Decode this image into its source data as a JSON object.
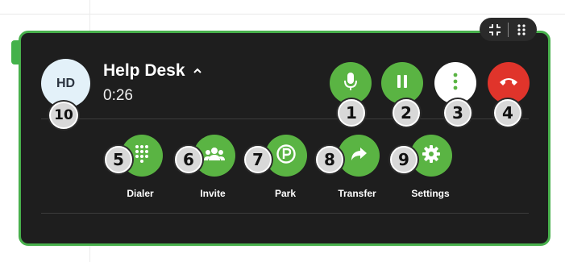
{
  "call": {
    "contact_initials": "HD",
    "contact_name": "Help Desk",
    "duration": "0:26"
  },
  "controls": {
    "mute_icon": "microphone-icon",
    "hold_icon": "pause-icon",
    "more_icon": "vertical-ellipsis-icon",
    "hangup_icon": "hangup-phone-icon"
  },
  "actions": [
    {
      "label": "Dialer",
      "icon": "keypad-icon"
    },
    {
      "label": "Invite",
      "icon": "people-icon"
    },
    {
      "label": "Park",
      "icon": "park-icon"
    },
    {
      "label": "Transfer",
      "icon": "forward-arrow-icon"
    },
    {
      "label": "Settings",
      "icon": "gear-icon"
    }
  ],
  "badges": [
    "1",
    "2",
    "3",
    "4",
    "5",
    "6",
    "7",
    "8",
    "9",
    "10"
  ],
  "colors": {
    "panel": "#1e1e1e",
    "border": "#48b04c",
    "action_green": "#5ab443",
    "hangup_red": "#e0342b",
    "avatar_bg": "#e3f1f9"
  }
}
